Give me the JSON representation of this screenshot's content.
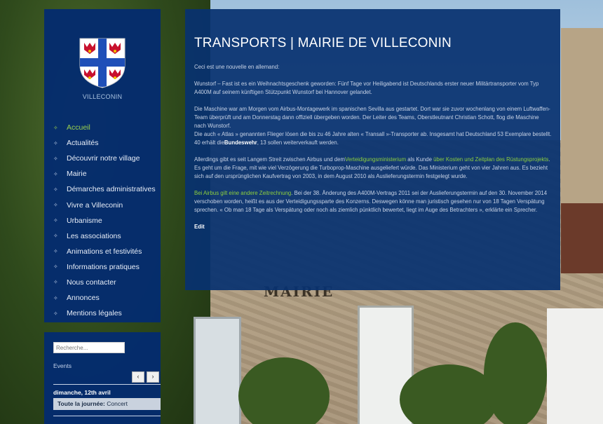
{
  "site": {
    "name": "VILLECONIN"
  },
  "menu": [
    {
      "label": "Accueil",
      "active": true
    },
    {
      "label": "Actualités"
    },
    {
      "label": "Découvrir notre village"
    },
    {
      "label": "Mairie"
    },
    {
      "label": "Démarches administratives"
    },
    {
      "label": "Vivre a Villeconin"
    },
    {
      "label": "Urbanisme"
    },
    {
      "label": "Les associations"
    },
    {
      "label": "Animations et festivités"
    },
    {
      "label": "Informations pratiques"
    },
    {
      "label": "Nous contacter"
    },
    {
      "label": "Annonces"
    },
    {
      "label": "Mentions légales"
    }
  ],
  "search": {
    "placeholder": "Recherche..."
  },
  "events": {
    "title": "Events",
    "prev": "‹",
    "next": "›",
    "date": "dimanche, 12th avril",
    "item_time": "Toute la journée:",
    "item_name": "Concert"
  },
  "article": {
    "title": "TRANSPORTS | MAIRIE DE VILLECONIN",
    "p1": "Ceci est une nouvelle en allemand:",
    "p2": "Wunstorf – Fast ist es ein Weihnachtsgeschenk geworden: Fünf Tage vor Heiligabend ist Deutschlands erster neuer Militärtransporter vom Typ A400M auf seinem künftigen Stützpunkt Wunstorf bei Hannover gelandet.",
    "p3a": "Die Maschine war am Morgen vom Airbus-Montagewerk im spanischen Sevilla aus gestartet. Dort war sie zuvor wochenlang von einem Luftwaffen-Team überprüft und am Donnerstag dann offiziell übergeben worden. Der Leiter des Teams, Oberstleutnant Christian Schott, flog die Maschine nach Wunstorf.",
    "p3b_pre": "Die auch « Atlas » genannten Flieger lösen die bis zu 46 Jahre alten « Transall »-Transporter ab. Insgesamt hat Deutschland 53 Exemplare bestellt. 40 erhält die",
    "p3b_bold": "Bundeswehr",
    "p3b_post": ", 13 sollen weiterverkauft werden.",
    "p4_pre": "Allerdings gibt es seit Langem Streit zwischen Airbus und dem",
    "p4_link1": "Verteidigungsministerium",
    "p4_mid": " als Kunde ",
    "p4_link2": "über Kosten und Zeitplan des Rüstungsprojekts",
    "p4_post": ". Es geht um die Frage, mit wie viel Verzögerung die Turboprop-Maschine ausgeliefert würde. Das Ministerium geht von vier Jahren aus. Es bezieht sich auf den ursprünglichen Kaufvertrag von 2003, in dem August 2010 als Auslieferungstermin festgelegt wurde.",
    "p5_link": "Bei Airbus gilt eine andere Zeitrechnung",
    "p5_post": ". Bei der 38. Änderung des A400M-Vertrags 2011 sei der Auslieferungstermin auf den 30. November 2014 verschoben worden, heißt es aus der Verteidigungssparte des Konzerns. Deswegen könne man juristisch gesehen nur von 18 Tagen Verspätung sprechen. « Ob man 18 Tage als Verspätung oder noch als ziemlich pünktlich bewertet, liegt im Auge des Betrachters », erklärte ein Sprecher.",
    "edit": "Edit"
  },
  "background": {
    "sign": "MAIRIE"
  },
  "colors": {
    "panel": "#042c6e",
    "accent": "#9bd14d"
  }
}
